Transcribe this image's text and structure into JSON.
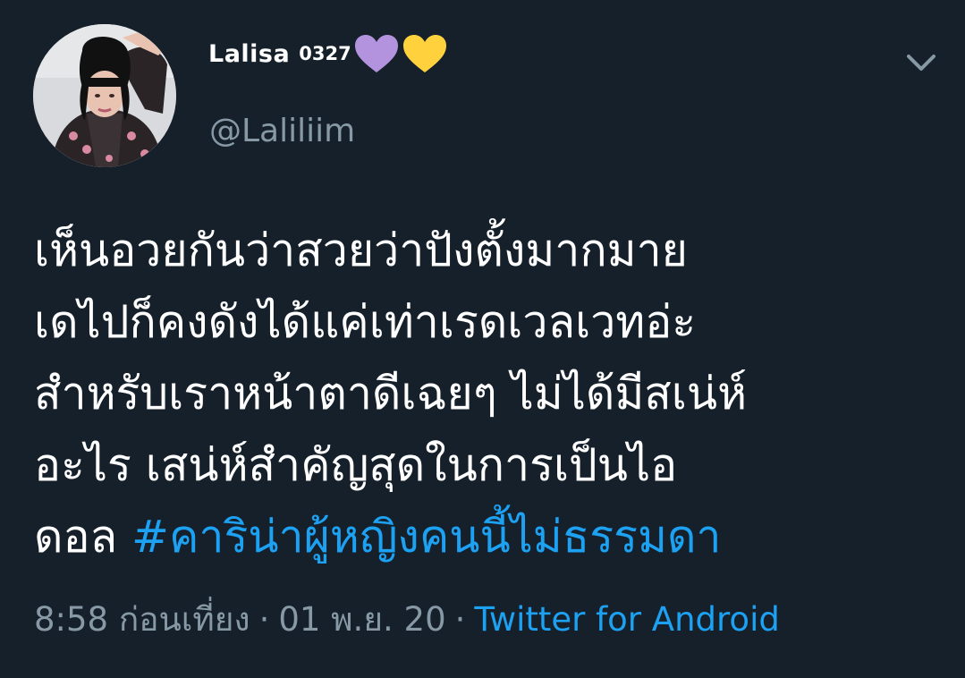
{
  "user": {
    "display_name": "Lalisa",
    "display_name_suffix": "0327",
    "handle": "@Laliliim",
    "avatar_description_icon": "profile-photo",
    "emoji": [
      {
        "name": "purple-heart-icon",
        "color": "#b493de"
      },
      {
        "name": "yellow-heart-icon",
        "color": "#ffd23d"
      }
    ]
  },
  "tweet": {
    "lines": [
      "เห็นอวยกันว่าสวยว่าปังตั้งมากมาย",
      "เดไปก็คงดังได้แค่เท่าเรดเวลเวทอ่ะ",
      "สำหรับเราหน้าตาดีเฉยๆ ไม่ได้มีสเน่ห์",
      "อะไร เสน่ห์สำคัญสุดในการเป็นไอ"
    ],
    "last_line_prefix": "ดอล ",
    "hashtag": "#คาริน่าผู้หญิงคนนี้ไม่ธรรมดา"
  },
  "meta": {
    "time": "8:58 ก่อนเที่ยง",
    "separator": "·",
    "date": "01 พ.ย. 20",
    "source": "Twitter for Android"
  },
  "colors": {
    "background": "#15202b",
    "text": "#ffffff",
    "secondary": "#8899a6",
    "link": "#1da1f2"
  },
  "icons": {
    "menu": "chevron-down-icon"
  }
}
